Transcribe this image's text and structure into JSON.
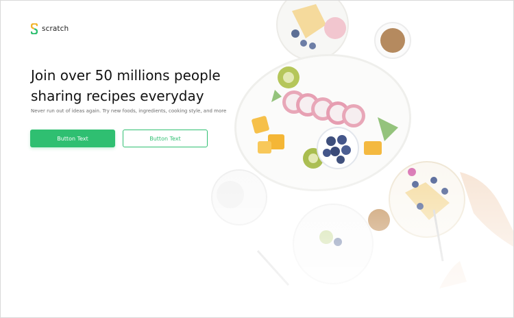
{
  "brand": {
    "name": "scratch",
    "icon": "scratch-logo-icon",
    "color": "#2fbf71"
  },
  "hero": {
    "headline_line1": "Join over 50 millions people",
    "headline_line2": "sharing recipes everyday",
    "subtitle": "Never run out of ideas again. Try new foods, ingredients, cooking style, and more"
  },
  "buttons": {
    "primary_label": "Button Text",
    "secondary_label": "Button Text"
  },
  "colors": {
    "accent": "#2fbf71",
    "text": "#111111",
    "muted": "#6b6b6b"
  }
}
